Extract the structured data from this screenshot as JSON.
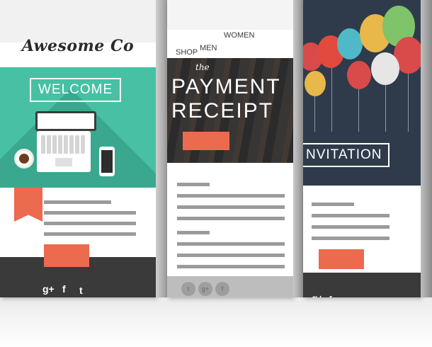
{
  "welcome_card": {
    "logo": "Awesome Co",
    "headline": "WELCOME",
    "social_icons": [
      "google-plus-icon",
      "facebook-icon",
      "twitter-icon"
    ],
    "social_glyphs": [
      "g+",
      "f",
      "t"
    ],
    "accent": "#48c0a3",
    "button_color": "#ec6a4e"
  },
  "receipt_card": {
    "nav": [
      "SHOP",
      "MEN",
      "WOMEN"
    ],
    "kicker": "the",
    "title_line1": "PAYMENT",
    "title_line2": "RECEIPT",
    "social_glyphs": [
      "t",
      "g+",
      "f"
    ],
    "button_color": "#ec6a4e"
  },
  "invite_card": {
    "headline": "NVITATION",
    "social_glyphs": [
      "g+",
      "f",
      "t"
    ],
    "balloon_colors": [
      "#e8b84a",
      "#d94a4a",
      "#4fb9c7",
      "#7fc36b",
      "#e6e6e6"
    ]
  }
}
